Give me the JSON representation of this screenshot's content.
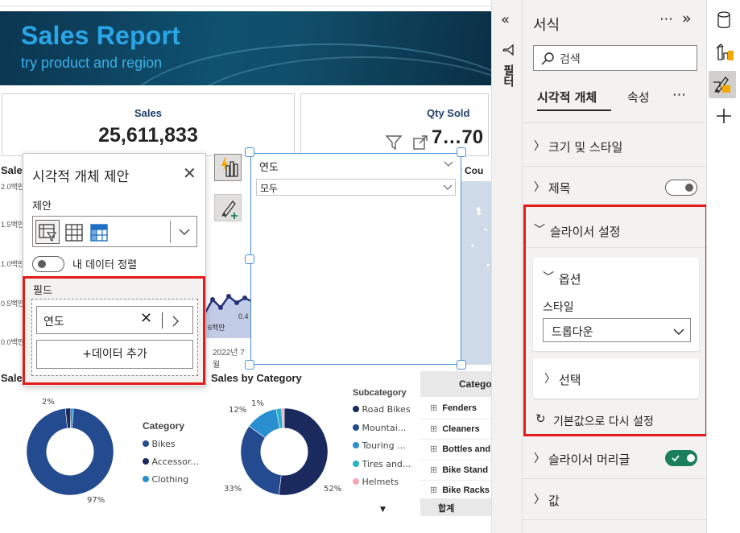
{
  "report": {
    "title": "Sales Report",
    "subtitle": "try product and region",
    "cards": [
      {
        "title": "Sales",
        "value": "25,611,833"
      },
      {
        "title": "Qty Sold",
        "value": "7…70"
      }
    ],
    "line_chart": {
      "title": "Sale",
      "y_ticks": [
        "2.0백만",
        "1.5백만",
        "1.0백만",
        "0.5백만",
        "0.0백만"
      ],
      "label_6": "6백만",
      "label_04": "0.4",
      "x_label": "2022년 7월"
    },
    "map_title": "y Cou",
    "donut1": {
      "title": "Sale",
      "legend_title": "Category",
      "legend": [
        "Bikes",
        "Accessor...",
        "Clothing"
      ],
      "labels": [
        "2%",
        "97%"
      ]
    },
    "donut2": {
      "title": "Sales by Category",
      "legend_title": "Subcategory",
      "legend": [
        "Road Bikes",
        "Mountai...",
        "Touring ...",
        "Tires and...",
        "Helmets"
      ],
      "labels": [
        "1%",
        "12%",
        "33%",
        "52%"
      ]
    },
    "table": {
      "header": "Catego",
      "rows": [
        "Fenders",
        "Cleaners",
        "Bottles and",
        "Bike Stand",
        "Bike Racks"
      ],
      "total": "합계"
    }
  },
  "chart_data": [
    {
      "type": "pie",
      "categories": [
        "Bikes",
        "Accessor...",
        "Clothing"
      ],
      "values": [
        97,
        2,
        1
      ],
      "colors": [
        "#244a8f",
        "#1b2a5e",
        "#2a8fd0"
      ]
    },
    {
      "type": "pie",
      "categories": [
        "Road Bikes",
        "Mountai...",
        "Touring ...",
        "Tires and...",
        "Helmets"
      ],
      "values": [
        52,
        33,
        12,
        2,
        1
      ],
      "colors": [
        "#1b2a5e",
        "#244a8f",
        "#2a8fd0",
        "#27b0c9",
        "#f4a6b8"
      ]
    }
  ],
  "popup": {
    "title": "시각적 개체 제안",
    "suggest_label": "제안",
    "sort_label": "내 데이터 정렬",
    "fields_label": "필드",
    "field_value": "연도",
    "add_data": "+데이터 추가"
  },
  "slicer": {
    "header": "연도",
    "dropdown": "모두"
  },
  "filter_strip": {
    "label": "필터"
  },
  "format_pane": {
    "title": "서식",
    "search_placeholder": "검색",
    "tabs": [
      "시각적 개체",
      "속성"
    ],
    "more": "⋯",
    "sections": {
      "size_style": "크기 및 스타일",
      "title_section": "제목",
      "slicer_settings": "슬라이서 설정",
      "options": "옵션",
      "style_label": "스타일",
      "style_value": "드롭다운",
      "selection": "선택",
      "reset": "기본값으로 다시 설정",
      "slicer_header": "슬라이서 머리글",
      "values": "값"
    }
  },
  "colors": {
    "accent_red": "#e31b1b",
    "toggle_on": "#1b7f5e",
    "banner_title": "#2aa6e8"
  }
}
